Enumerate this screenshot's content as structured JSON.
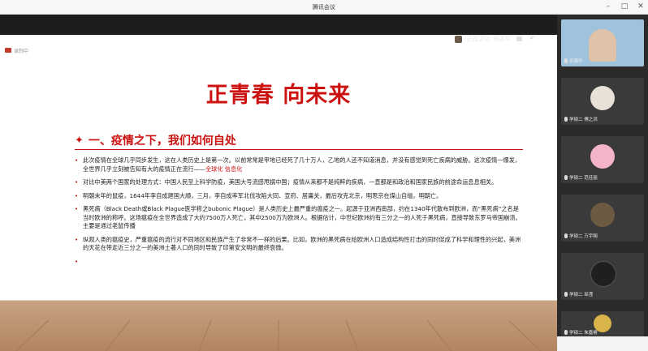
{
  "window": {
    "title": "腾讯会议"
  },
  "meeting": {
    "speaker_label": "正在讲话: 宋清华"
  },
  "slide": {
    "tag_label": "录制中",
    "title": "正青春  向未来",
    "section_heading": "一、疫情之下，我们如何自处",
    "paragraphs": [
      {
        "lead": "此次疫情在全球几乎同步发生，这在人类历史上是第一次。以前常常是甲地已经死了几十万人，乙地的人还不知道消息，并没有感觉到死亡疾病的威胁。这次疫情一爆发，全世界几乎立刻被告知有大的疫情正在流行——",
        "highlight": "全球化  信息化"
      },
      {
        "lead": "对比中美两个国家的处理方式：中国人民至上科学防疫，美国大号流感甩锅中国；疫情从来都不是纯粹的疾病，一直都是和政治和国家民族的前途命运息息相关。",
        "highlight": ""
      },
      {
        "lead": "明朝末年的鼠疫，1644年李自成建国大顺，三月，李自成率军北伐攻陷大同、宣府、居庸关，最后攻克北京，明思宗在煤山自缢，明朝亡。",
        "highlight": ""
      },
      {
        "lead": "黑死病（Black Death或Black Plague医学称之bubonic Plague）是人类历史上最严重的瘟疫之一。起源于亚洲西南部，约在1340年代散布到欧洲，而“黑死病”之名是当时欧洲的称呼。这场瘟疫在全世界造成了大约7500万人死亡，其中2500万为欧洲人。根据估计，中世纪欧洲约有三分之一的人死于黑死病，直接导致东罗马帝国崩溃。主要是通过老鼠传播",
        "highlight": ""
      },
      {
        "lead": "纵观人类的瘟疫史，严重瘟疫的流行对不同地区和民族产生了非常不一样的后果。比如，欧洲的黑死病在给欧洲人口造成结构性打击的同时促成了科学和理性的兴起，美洲的天花在带走近三分之一的美洲土著人口的同时导致了印第安文明的最终衰微。",
        "highlight": ""
      },
      {
        "lead": "",
        "highlight": ""
      }
    ]
  },
  "participants": [
    {
      "name": "宋清华",
      "avatar_color": "#7aa6c8",
      "bg": "#9fc3dd",
      "icon": "person-photo"
    },
    {
      "name": "学硕二 傅之洪",
      "avatar_color": "#e8e1d8",
      "bg": "#3a3a3a",
      "icon": "cat-avatar"
    },
    {
      "name": "学硕二 范佳丽",
      "avatar_color": "#f3b4c7",
      "bg": "#3a3a3a",
      "icon": "anime-avatar"
    },
    {
      "name": "学硕二 万宇翔",
      "avatar_color": "#6d5a43",
      "bg": "#3a3a3a",
      "icon": "dog-avatar"
    },
    {
      "name": "学硕二 巫滢",
      "avatar_color": "#2b2b2b",
      "bg": "#3a3a3a",
      "icon": "mask-avatar"
    },
    {
      "name": "学硕二 朱嘉睿",
      "avatar_color": "#d9b44a",
      "bg": "#3a3a3a",
      "icon": "flower-avatar"
    }
  ],
  "colors": {
    "accent_red": "#cc1111",
    "floor": "#c9a382"
  }
}
